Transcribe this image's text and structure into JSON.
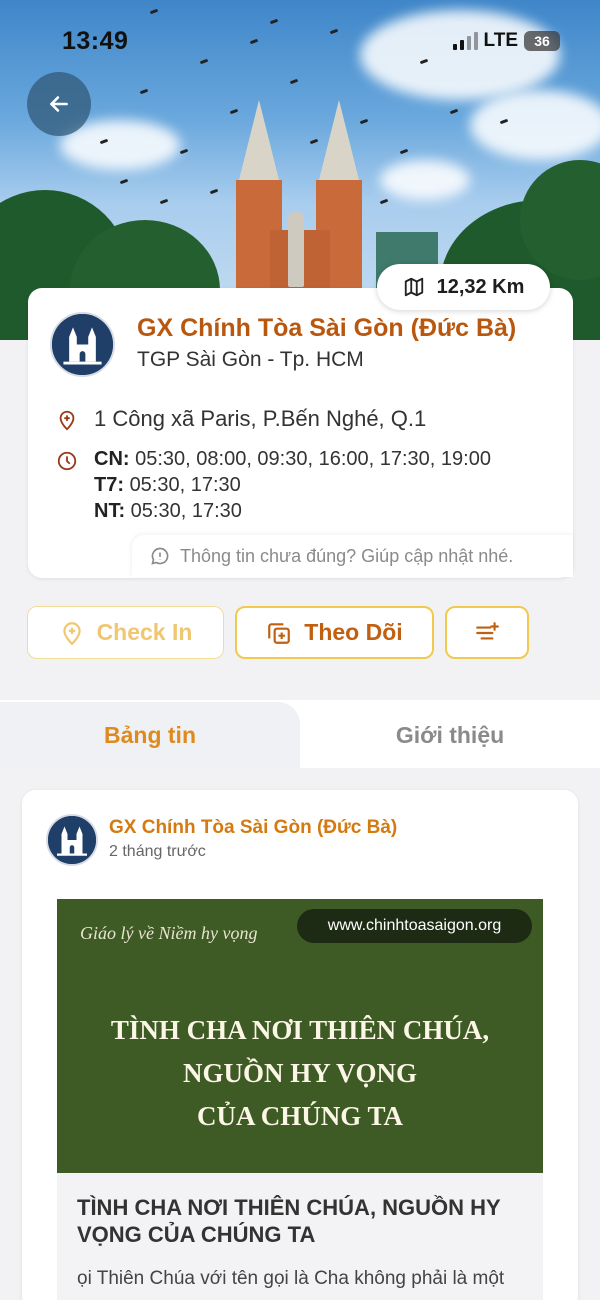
{
  "status_bar": {
    "time": "13:49",
    "network": "LTE",
    "battery": "36"
  },
  "hero": {
    "distance": "12,32 Km"
  },
  "church": {
    "name": "GX Chính Tòa Sài Gòn (Đức Bà)",
    "diocese": "TGP Sài Gòn - Tp. HCM",
    "address": "1 Công xã Paris, P.Bến Nghé, Q.1",
    "mass_times": [
      {
        "day": "CN:",
        "times": "05:30, 08:00, 09:30, 16:00, 17:30, 19:00"
      },
      {
        "day": "T7:",
        "times": "05:30, 17:30"
      },
      {
        "day": "NT:",
        "times": "05:30, 17:30"
      }
    ],
    "feedback": "Thông tin chưa đúng? Giúp cập nhật nhé."
  },
  "actions": {
    "check_in": "Check In",
    "follow": "Theo Dõi"
  },
  "tabs": {
    "news": "Bảng tin",
    "about": "Giới thiệu"
  },
  "post": {
    "author": "GX Chính Tòa Sài Gòn (Đức Bà)",
    "time": "2 tháng trước",
    "image": {
      "subtitle": "Giáo lý về Niềm hy vọng",
      "url": "www.chinhtoasaigon.org",
      "headline_lines": [
        "TÌNH CHA NƠI THIÊN CHÚA,",
        "NGUỒN HY VỌNG",
        "CỦA CHÚNG TA"
      ]
    },
    "title": "TÌNH CHA NƠI THIÊN CHÚA, NGUỒN HY VỌNG CỦA CHÚNG TA",
    "excerpt": "ọi Thiên Chúa với tên gọi là Cha không phải là một"
  },
  "colors": {
    "accent_orange": "#b9570f",
    "tab_orange": "#e08a1e",
    "button_border": "#f2c94c",
    "post_green": "#3e5a25"
  }
}
